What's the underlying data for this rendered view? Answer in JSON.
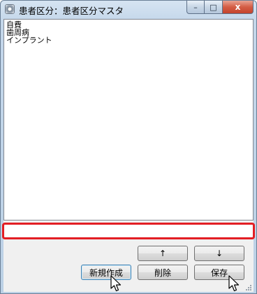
{
  "window": {
    "title": "患者区分：患者区分マスタ",
    "controls": {
      "minimize": "–",
      "maximize": "□",
      "close": "x"
    }
  },
  "list": {
    "items": [
      "自費",
      "歯周病",
      "インプラント"
    ]
  },
  "input": {
    "value": "",
    "placeholder": ""
  },
  "buttons": {
    "up": "↑",
    "down": "↓",
    "new": "新規作成",
    "delete": "削除",
    "save": "保存"
  },
  "icons": {
    "app": "gear-icon",
    "cursor": "mouse-pointer-icon",
    "resize": "resize-grip-icon"
  },
  "colors": {
    "highlight_border": "#e31e24",
    "close_button": "#c4442d",
    "default_button_border": "#3c7fb1"
  }
}
